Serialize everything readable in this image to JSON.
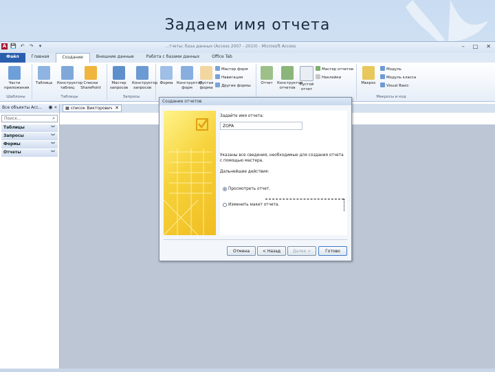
{
  "slide": {
    "title": "Задаем имя отчета"
  },
  "window": {
    "title": "…тчеты: база данных (Access 2007 - 2010) - Microsoft Access",
    "qat": [
      "A",
      "💾",
      "↶",
      "↷",
      "▾"
    ],
    "controls": [
      "–",
      "□",
      "✕"
    ]
  },
  "ribbon_tabs": [
    "Файл",
    "Главная",
    "Создание",
    "Внешние данные",
    "Работа с базами данных",
    "Office Tab"
  ],
  "ribbon": {
    "groups": [
      {
        "label": "Шаблоны",
        "buttons": [
          "Части приложения"
        ]
      },
      {
        "label": "Таблицы",
        "buttons": [
          "Таблица",
          "Конструктор таблиц",
          "Списки SharePoint"
        ]
      },
      {
        "label": "Запросы",
        "buttons": [
          "Мастер запросов",
          "Конструктор запросов"
        ]
      },
      {
        "label": "",
        "buttons": [
          "Форма",
          "Конструктор форм",
          "Пустая форма"
        ],
        "small": [
          "Мастер форм",
          "Навигация",
          "Другие формы"
        ]
      },
      {
        "label": "",
        "buttons": [
          "Отчет",
          "Конструктор отчетов",
          "Пустой отчет"
        ],
        "small": [
          "Мастер отчетов",
          "Наклейки"
        ]
      },
      {
        "label": "Макросы и код",
        "buttons": [
          "Макрос"
        ],
        "small": [
          "Модуль",
          "Модуль класса",
          "Visual Basic"
        ]
      }
    ]
  },
  "nav": {
    "header": "Все объекты Acc...",
    "search_placeholder": "Поиск...",
    "categories": [
      "Таблицы",
      "Запросы",
      "Формы",
      "Отчеты"
    ]
  },
  "doc_tab": {
    "label": "список Викторович"
  },
  "dialog": {
    "title": "Создание отчетов",
    "name_prompt": "Задайте имя отчета:",
    "name_value": "ZOPA",
    "info_text_1": "Указаны все сведения, необходимые для создания отчета",
    "info_text_2": "с помощью мастера.",
    "next_action_label": "Дальнейшие действия:",
    "options": [
      {
        "label": "Просмотреть отчет.",
        "selected": true
      },
      {
        "label": "Изменить макет отчета.",
        "selected": false
      }
    ],
    "buttons": {
      "cancel": "Отмена",
      "back": "< Назад",
      "next": "Далее >",
      "finish": "Готово"
    }
  }
}
